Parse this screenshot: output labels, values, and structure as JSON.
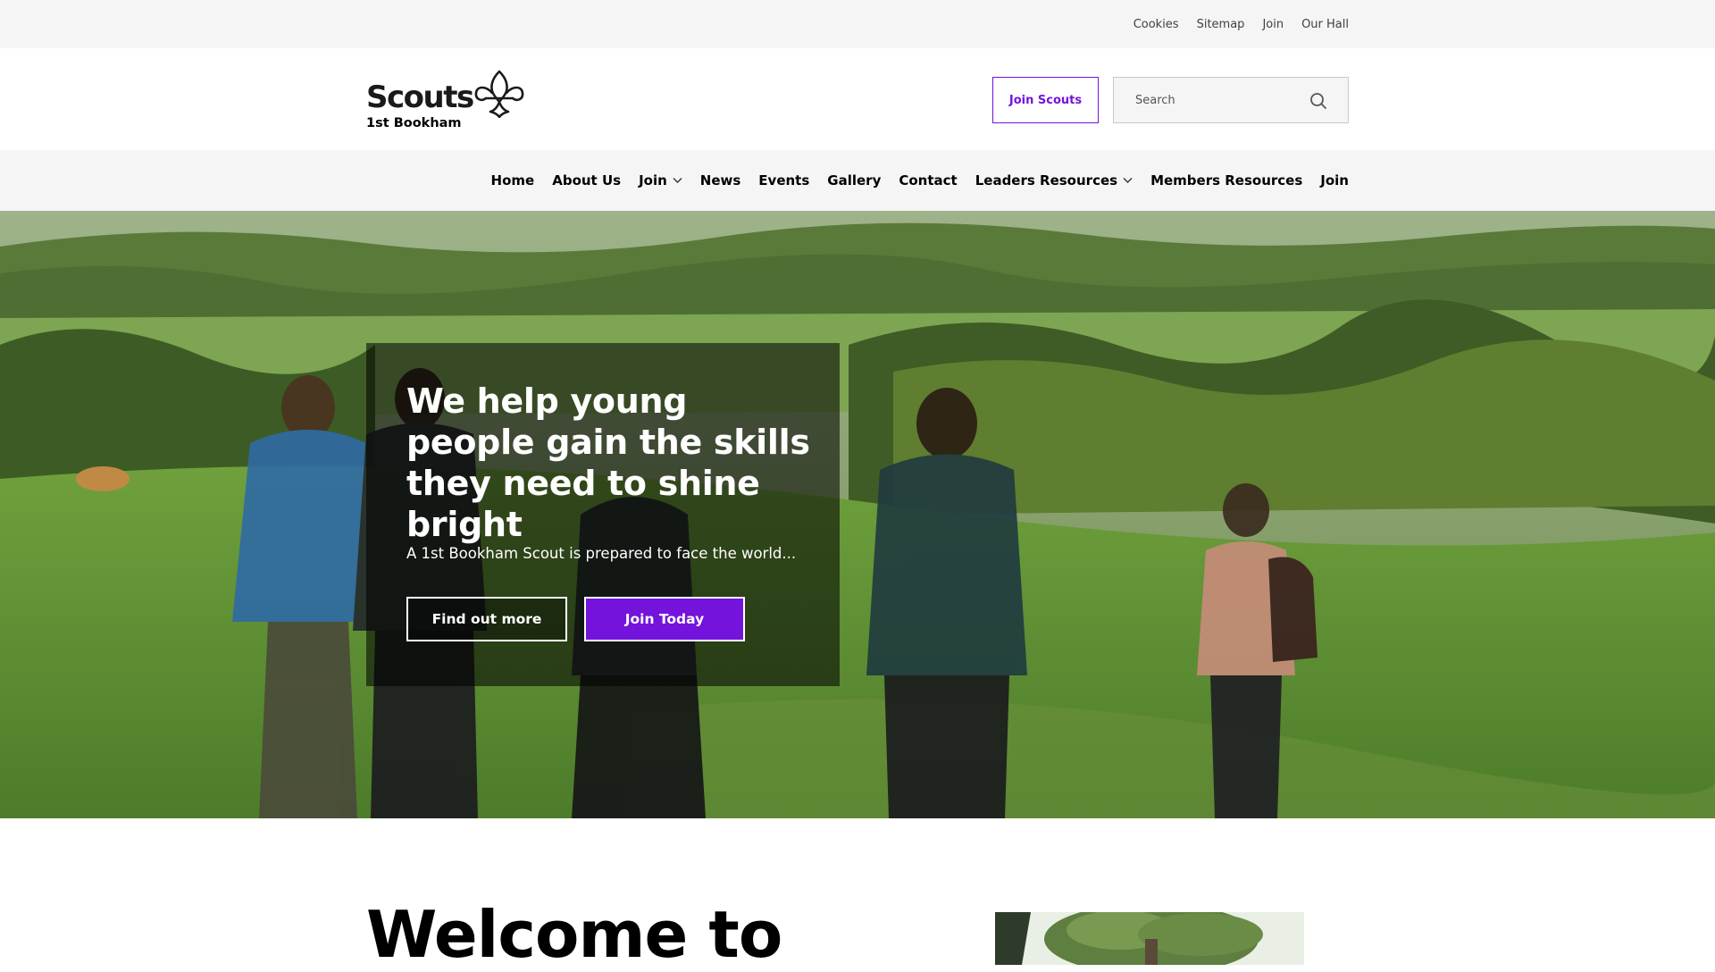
{
  "utility_nav": {
    "links": [
      "Cookies",
      "Sitemap",
      "Join",
      "Our Hall"
    ]
  },
  "header": {
    "logo_word": "Scouts",
    "logo_group": "1st Bookham",
    "join_button": "Join Scouts",
    "search_placeholder": "Search"
  },
  "nav": {
    "items": [
      {
        "label": "Home",
        "dropdown": false
      },
      {
        "label": "About Us",
        "dropdown": false
      },
      {
        "label": "Join",
        "dropdown": true
      },
      {
        "label": "News",
        "dropdown": false
      },
      {
        "label": "Events",
        "dropdown": false
      },
      {
        "label": "Gallery",
        "dropdown": false
      },
      {
        "label": "Contact",
        "dropdown": false
      },
      {
        "label": "Leaders Resources",
        "dropdown": true
      },
      {
        "label": "Members Resources",
        "dropdown": false
      },
      {
        "label": "Join",
        "dropdown": false
      }
    ]
  },
  "hero": {
    "title": "We help young people gain the skills they need to shine bright",
    "subtitle": "A 1st Bookham Scout is prepared to face the world...",
    "primary_button": "Find out more",
    "secondary_button": "Join Today"
  },
  "welcome": {
    "heading": "Welcome to"
  },
  "colors": {
    "brand_purple": "#7413dc",
    "bar_grey": "#f5f5f5"
  },
  "icons": {
    "logo": "fleur-de-lis-icon",
    "search": "search-icon",
    "dropdown": "chevron-down-icon"
  }
}
